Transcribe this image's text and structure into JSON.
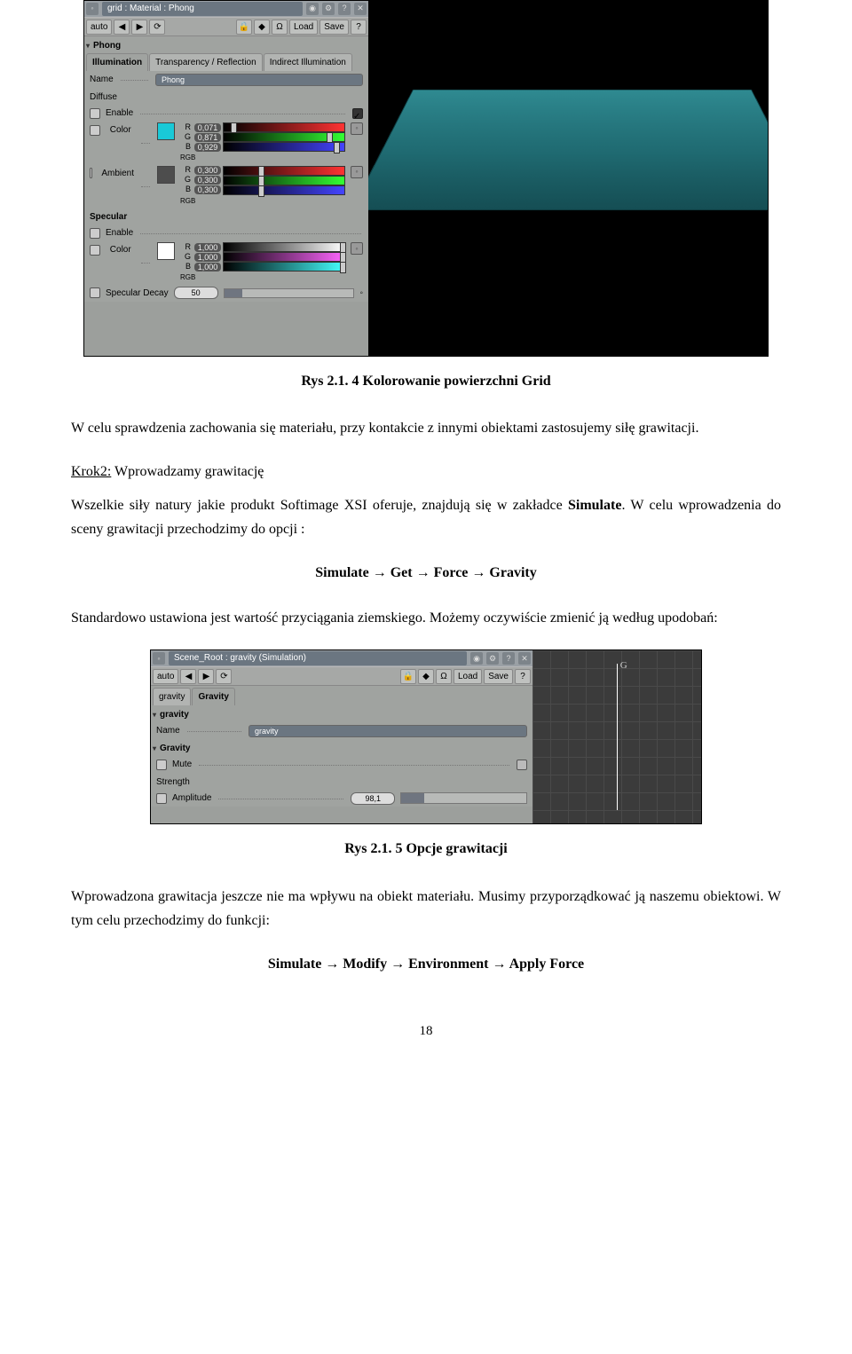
{
  "fig1": {
    "title": "grid : Material : Phong",
    "toolbar": {
      "auto": "auto",
      "load": "Load",
      "save": "Save"
    },
    "section_phong": "Phong",
    "tabs": [
      "Illumination",
      "Transparency / Reflection",
      "Indirect Illumination"
    ],
    "name_label": "Name",
    "name_value": "Phong",
    "diffuse_title": "Diffuse",
    "enable": "Enable",
    "color": "Color",
    "ambient": "Ambient",
    "rgb": "RGB",
    "diffuse_color": {
      "R": "0,071",
      "G": "0,871",
      "B": "0,929"
    },
    "ambient_color": {
      "R": "0,300",
      "G": "0,300",
      "B": "0,300"
    },
    "specular_title": "Specular",
    "specular_color": {
      "R": "1,000",
      "G": "1,000",
      "B": "1,000"
    },
    "specular_decay": "Specular Decay",
    "specular_decay_value": "50"
  },
  "caption1": "Rys 2.1. 4 Kolorowanie powierzchni Grid",
  "para1": "W celu sprawdzenia zachowania się materiału, przy kontakcie z innymi obiektami zastosujemy siłę grawitacji.",
  "krok2_label": "Krok2:",
  "krok2_rest": " Wprowadzamy grawitację",
  "para2a": "Wszelkie siły natury jakie produkt Softimage XSI oferuje, znajdują się w zakładce ",
  "para2b": "Simulate",
  "para2c": ". W celu wprowadzenia do sceny grawitacji przechodzimy do opcji :",
  "menu1": "Simulate → Get → Force → Gravity",
  "para3": "Standardowo ustawiona jest wartość przyciągania ziemskiego. Możemy oczywiście zmienić ją według upodobań:",
  "fig2": {
    "title": "Scene_Root : gravity (Simulation)",
    "toolbar": {
      "auto": "auto",
      "load": "Load",
      "save": "Save"
    },
    "tabs": [
      "gravity",
      "Gravity"
    ],
    "section_gravity": "gravity",
    "name_label": "Name",
    "name_value": "gravity",
    "section_gravity2": "Gravity",
    "mute": "Mute",
    "strength": "Strength",
    "amplitude": "Amplitude",
    "amplitude_value": "98,1",
    "gizmo_label": "G"
  },
  "caption2": "Rys 2.1. 5 Opcje grawitacji",
  "para4": "Wprowadzona grawitacja jeszcze nie ma wpływu na obiekt materiału. Musimy przyporządkować ją naszemu obiektowi. W tym celu przechodzimy do funkcji:",
  "menu2": "Simulate → Modify → Environment → Apply Force",
  "page": "18"
}
